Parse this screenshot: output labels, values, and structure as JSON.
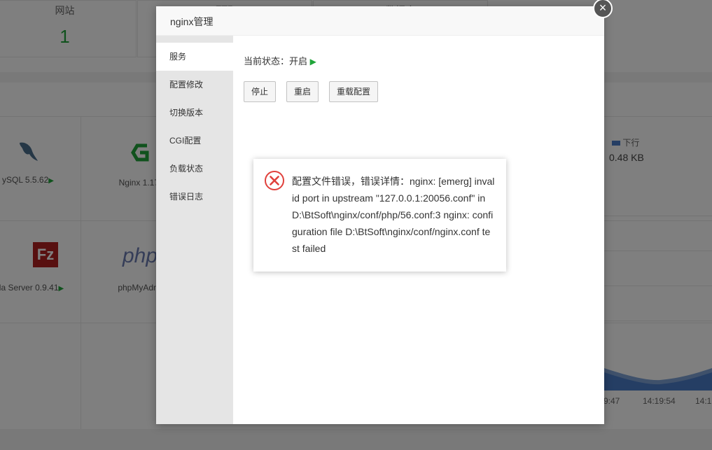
{
  "background": {
    "stat_cards": [
      {
        "title": "网站",
        "value": "1"
      },
      {
        "title": "FTP",
        "value": ""
      },
      {
        "title": "数据库",
        "value": ""
      }
    ],
    "software": [
      {
        "label": "ySQL 5.5.62",
        "icon": "dolphin-icon"
      },
      {
        "label": "Nginx 1.17.",
        "icon": "nginx-icon"
      },
      {
        "label": "la Server 0.9.41",
        "icon": "filezilla-icon"
      },
      {
        "label": "phpMyAdmi",
        "icon": "php-icon"
      }
    ],
    "traffic": {
      "legend": "下行",
      "value": "0.48 KB"
    },
    "chart_ticks": [
      "9:47",
      "14:19:54",
      "14:1"
    ],
    "colors": {
      "accent_green": "#20a53a",
      "chart_blue": "#4a7dc8"
    }
  },
  "modal": {
    "title": "nginx管理",
    "close_symbol": "×",
    "sidebar": [
      "服务",
      "配置修改",
      "切换版本",
      "CGI配置",
      "负载状态",
      "错误日志"
    ],
    "active_item": "服务",
    "status_label": "当前状态：",
    "status_value": "开启",
    "buttons": {
      "stop": "停止",
      "restart": "重启",
      "reload": "重载配置"
    }
  },
  "error_dialog": {
    "icon": "error-x-icon",
    "message": "配置文件错误，错误详情：nginx: [emerg] invalid port in upstream \"127.0.0.1:20056.conf\" in D:\\BtSoft\\nginx/conf/php/56.conf:3 nginx: configuration file D:\\BtSoft\\nginx/conf/nginx.conf test failed"
  }
}
